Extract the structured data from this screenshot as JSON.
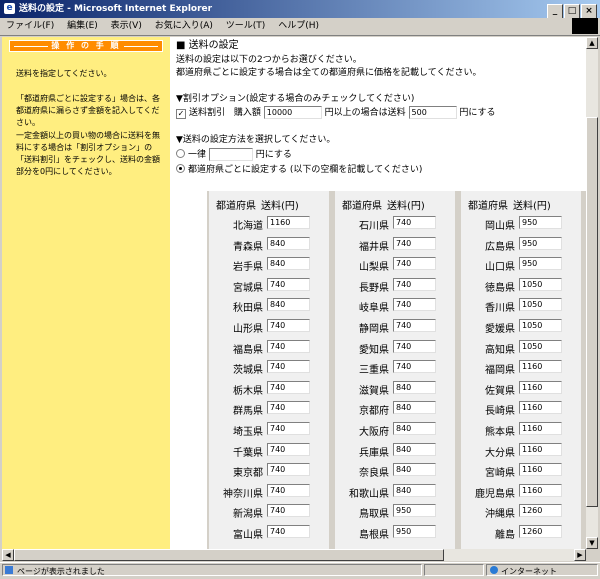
{
  "window": {
    "title": "送料の設定 - Microsoft Internet Explorer"
  },
  "menu": [
    "ファイル(F)",
    "編集(E)",
    "表示(V)",
    "お気に入り(A)",
    "ツール(T)",
    "ヘルプ(H)"
  ],
  "sidebar": {
    "header": "操 作 の 手 順",
    "para1": "送料を指定してください。",
    "para2": "「都道府県ごとに設定する」場合は、各都道府県に漏らさず金額を記入してください。",
    "para3": "一定金額以上の買い物の場合に送料を無料にする場合は「割引オプション」の「送料割引」をチェックし、送料の金額部分を0円にしてください。"
  },
  "main": {
    "section_title": "■ 送料の設定",
    "intro1": "送料の設定は以下の2つからお選びください。",
    "intro2": "都道府県ごとに設定する場合は全ての都道府県に価格を記載してください。",
    "discount_heading": "▼割引オプション(設定する場合のみチェックしてください)",
    "discount_checkbox_label": "送料割引",
    "discount_checked": true,
    "purchase_label": "購入額",
    "purchase_value": "10000",
    "above_text": "円以上の場合は送料",
    "discount_fee": "500",
    "yen_suffix": "円にする",
    "method_heading": "▼送料の設定方法を選択してください。",
    "flat_label": "一律",
    "flat_value": "",
    "flat_suffix": "円にする",
    "per_pref_label": "都道府県ごとに設定する (以下の空欄を記載してください)",
    "selected_method": "per_prefecture"
  },
  "grid": {
    "header_pref": "都道府県",
    "header_fee": "送料(円)",
    "columns": [
      [
        [
          "北海道",
          "1160"
        ],
        [
          "青森県",
          "840"
        ],
        [
          "岩手県",
          "840"
        ],
        [
          "宮城県",
          "740"
        ],
        [
          "秋田県",
          "840"
        ],
        [
          "山形県",
          "740"
        ],
        [
          "福島県",
          "740"
        ],
        [
          "茨城県",
          "740"
        ],
        [
          "栃木県",
          "740"
        ],
        [
          "群馬県",
          "740"
        ],
        [
          "埼玉県",
          "740"
        ],
        [
          "千葉県",
          "740"
        ],
        [
          "東京都",
          "740"
        ],
        [
          "神奈川県",
          "740"
        ],
        [
          "新潟県",
          "740"
        ],
        [
          "富山県",
          "740"
        ]
      ],
      [
        [
          "石川県",
          "740"
        ],
        [
          "福井県",
          "740"
        ],
        [
          "山梨県",
          "740"
        ],
        [
          "長野県",
          "740"
        ],
        [
          "岐阜県",
          "740"
        ],
        [
          "静岡県",
          "740"
        ],
        [
          "愛知県",
          "740"
        ],
        [
          "三重県",
          "740"
        ],
        [
          "滋賀県",
          "840"
        ],
        [
          "京都府",
          "840"
        ],
        [
          "大阪府",
          "840"
        ],
        [
          "兵庫県",
          "840"
        ],
        [
          "奈良県",
          "840"
        ],
        [
          "和歌山県",
          "840"
        ],
        [
          "鳥取県",
          "950"
        ],
        [
          "島根県",
          "950"
        ]
      ],
      [
        [
          "岡山県",
          "950"
        ],
        [
          "広島県",
          "950"
        ],
        [
          "山口県",
          "950"
        ],
        [
          "徳島県",
          "1050"
        ],
        [
          "香川県",
          "1050"
        ],
        [
          "愛媛県",
          "1050"
        ],
        [
          "高知県",
          "1050"
        ],
        [
          "福岡県",
          "1160"
        ],
        [
          "佐賀県",
          "1160"
        ],
        [
          "長崎県",
          "1160"
        ],
        [
          "熊本県",
          "1160"
        ],
        [
          "大分県",
          "1160"
        ],
        [
          "宮崎県",
          "1160"
        ],
        [
          "鹿児島県",
          "1160"
        ],
        [
          "沖縄県",
          "1260"
        ],
        [
          "離島",
          "1260"
        ]
      ]
    ]
  },
  "status": {
    "text": "ページが表示されました",
    "zone": "インターネット"
  }
}
